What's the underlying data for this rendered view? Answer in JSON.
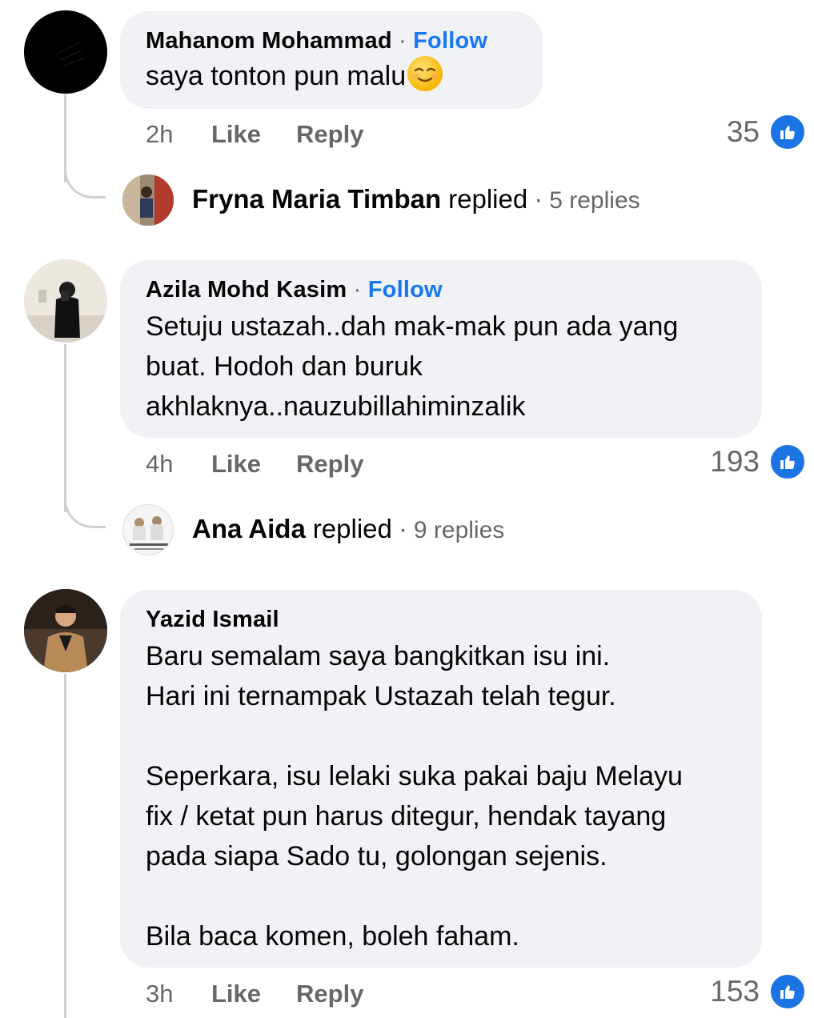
{
  "comments": [
    {
      "author": "Mahanom Mohammad",
      "follow_label": "Follow",
      "text": "saya tonton pun malu",
      "emoji": "relieved-face-emoji",
      "time": "2h",
      "like_label": "Like",
      "reply_label": "Reply",
      "like_count": "35",
      "reply_summary": {
        "name": "Fryna Maria Timban",
        "verb": "replied",
        "count": "5 replies"
      }
    },
    {
      "author": "Azila Mohd Kasim",
      "follow_label": "Follow",
      "text": "Setuju ustazah..dah mak-mak pun ada yang\nbuat. Hodoh dan buruk\nakhlaknya..nauzubillahiminzalik",
      "time": "4h",
      "like_label": "Like",
      "reply_label": "Reply",
      "like_count": "193",
      "reply_summary": {
        "name": "Ana Aida",
        "verb": "replied",
        "count": "9 replies"
      }
    },
    {
      "author": "Yazid Ismail",
      "text": "Baru semalam saya bangkitkan isu ini.\nHari ini ternampak Ustazah telah tegur.\n\nSeperkara, isu lelaki suka pakai baju Melayu\nfix / ketat pun harus ditegur, hendak tayang\npada siapa Sado tu, golongan sejenis.\n\nBila baca komen, boleh faham.",
      "time": "3h",
      "like_label": "Like",
      "reply_label": "Reply",
      "like_count": "153"
    }
  ],
  "colors": {
    "bubble": "#f0f2f5",
    "follow": "#1877f2",
    "muted": "#65676b",
    "like_badge": "#1b74e4",
    "thread_line": "#ced0d4"
  }
}
